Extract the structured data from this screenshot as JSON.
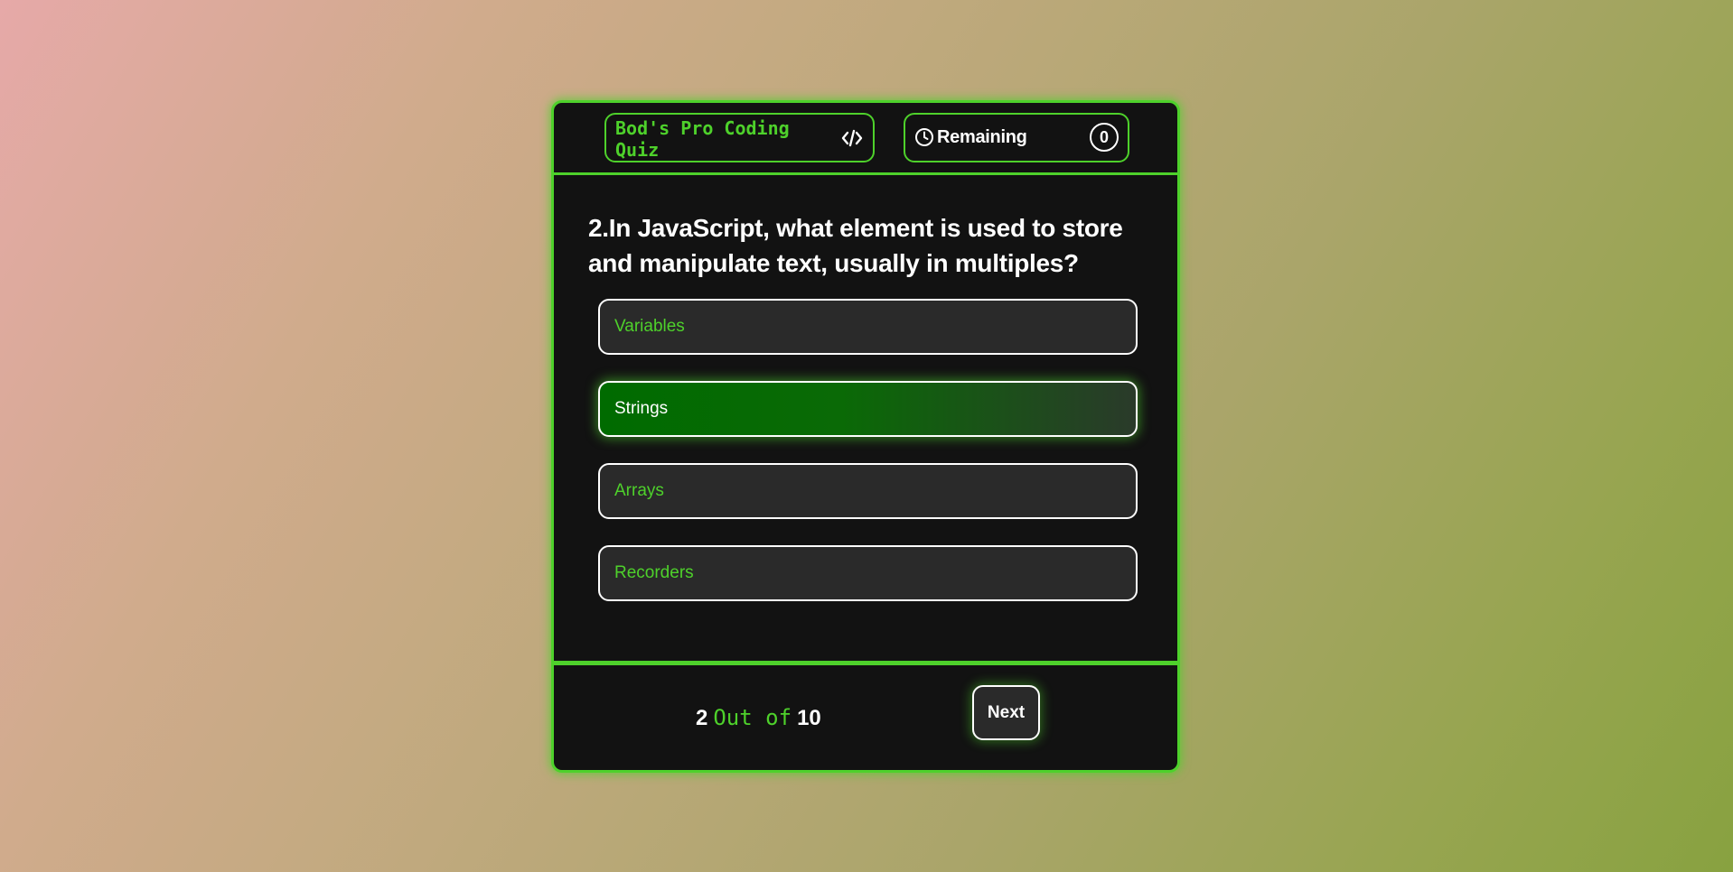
{
  "header": {
    "title": "Bod's Pro Coding Quiz",
    "title_icon": "code-icon",
    "timer_label": "Remaining",
    "timer_icon": "clock-icon",
    "timer_value": "0"
  },
  "question": {
    "text": "2.In JavaScript, what element is used to store and manipulate text, usually in multiples?"
  },
  "options": [
    {
      "label": "Variables",
      "selected": false
    },
    {
      "label": "Strings",
      "selected": true
    },
    {
      "label": "Arrays",
      "selected": false
    },
    {
      "label": "Recorders",
      "selected": false
    }
  ],
  "footer": {
    "current": "2",
    "separator": "Out of",
    "total": "10",
    "next_label": "Next"
  },
  "colors": {
    "accent": "#4ed12b",
    "card_bg": "#121212",
    "option_bg": "#2a2a2a",
    "selected_bg": "#006b00"
  }
}
